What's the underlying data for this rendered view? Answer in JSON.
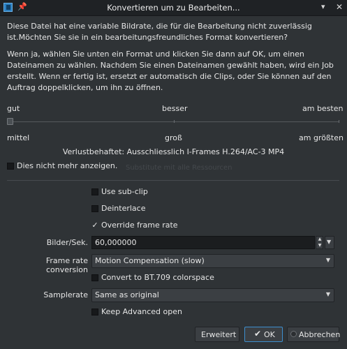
{
  "window": {
    "title": "Konvertieren um zu Bearbeiten...",
    "min_symbol": "▾",
    "close_symbol": "✕",
    "pin_symbol": "📌"
  },
  "intro": {
    "paragraph1": "Diese Datei hat eine variable Bildrate, die für die Bearbeitung nicht zuverlässig ist.Möchten Sie sie in ein bearbeitungsfreundliches Format konvertieren?",
    "paragraph2": "Wenn ja, wählen Sie unten ein Format und klicken Sie dann auf OK, um einen Dateinamen zu wählen. Nachdem Sie einen Dateinamen gewählt haben, wird ein Job erstellt. Wenn er fertig ist, ersetzt er automatisch die Clips, oder Sie können auf den Auftrag doppelklicken, um ihn zu öffnen."
  },
  "quality_slider": {
    "top_labels": [
      "gut",
      "besser",
      "am besten"
    ],
    "bottom_labels": [
      "mittel",
      "groß",
      "am größten"
    ],
    "value": 0
  },
  "format_note": "Verlustbehaftet: Ausschliesslich I-Frames H.264/AC-3 MP4",
  "dont_show": {
    "label": "Dies nicht mehr anzeigen.",
    "checked": false
  },
  "ghost_text": "Substitute mit alle Ressourcen",
  "options": {
    "use_subclip": {
      "label": "Use sub-clip",
      "checked": false
    },
    "deinterlace": {
      "label": "Deinterlace",
      "checked": false
    },
    "override_frame_rate": {
      "label": "Override frame rate",
      "checked": true
    },
    "fps_label": "Bilder/Sek.",
    "fps_value": "60,000000",
    "frame_rate_conversion_label": "Frame rate conversion",
    "frame_rate_conversion_value": "Motion Compensation (slow)",
    "bt709": {
      "label": "Convert to BT.709 colorspace",
      "checked": false
    },
    "samplerate_label": "Samplerate",
    "samplerate_value": "Same as original",
    "keep_advanced": {
      "label": "Keep Advanced open",
      "checked": false
    }
  },
  "buttons": {
    "advanced": "Erweitert",
    "ok": "OK",
    "cancel": "Abbrechen"
  },
  "colors": {
    "background": "#2f3336",
    "titlebar": "#1f2225",
    "accent": "#3d8fcf"
  }
}
